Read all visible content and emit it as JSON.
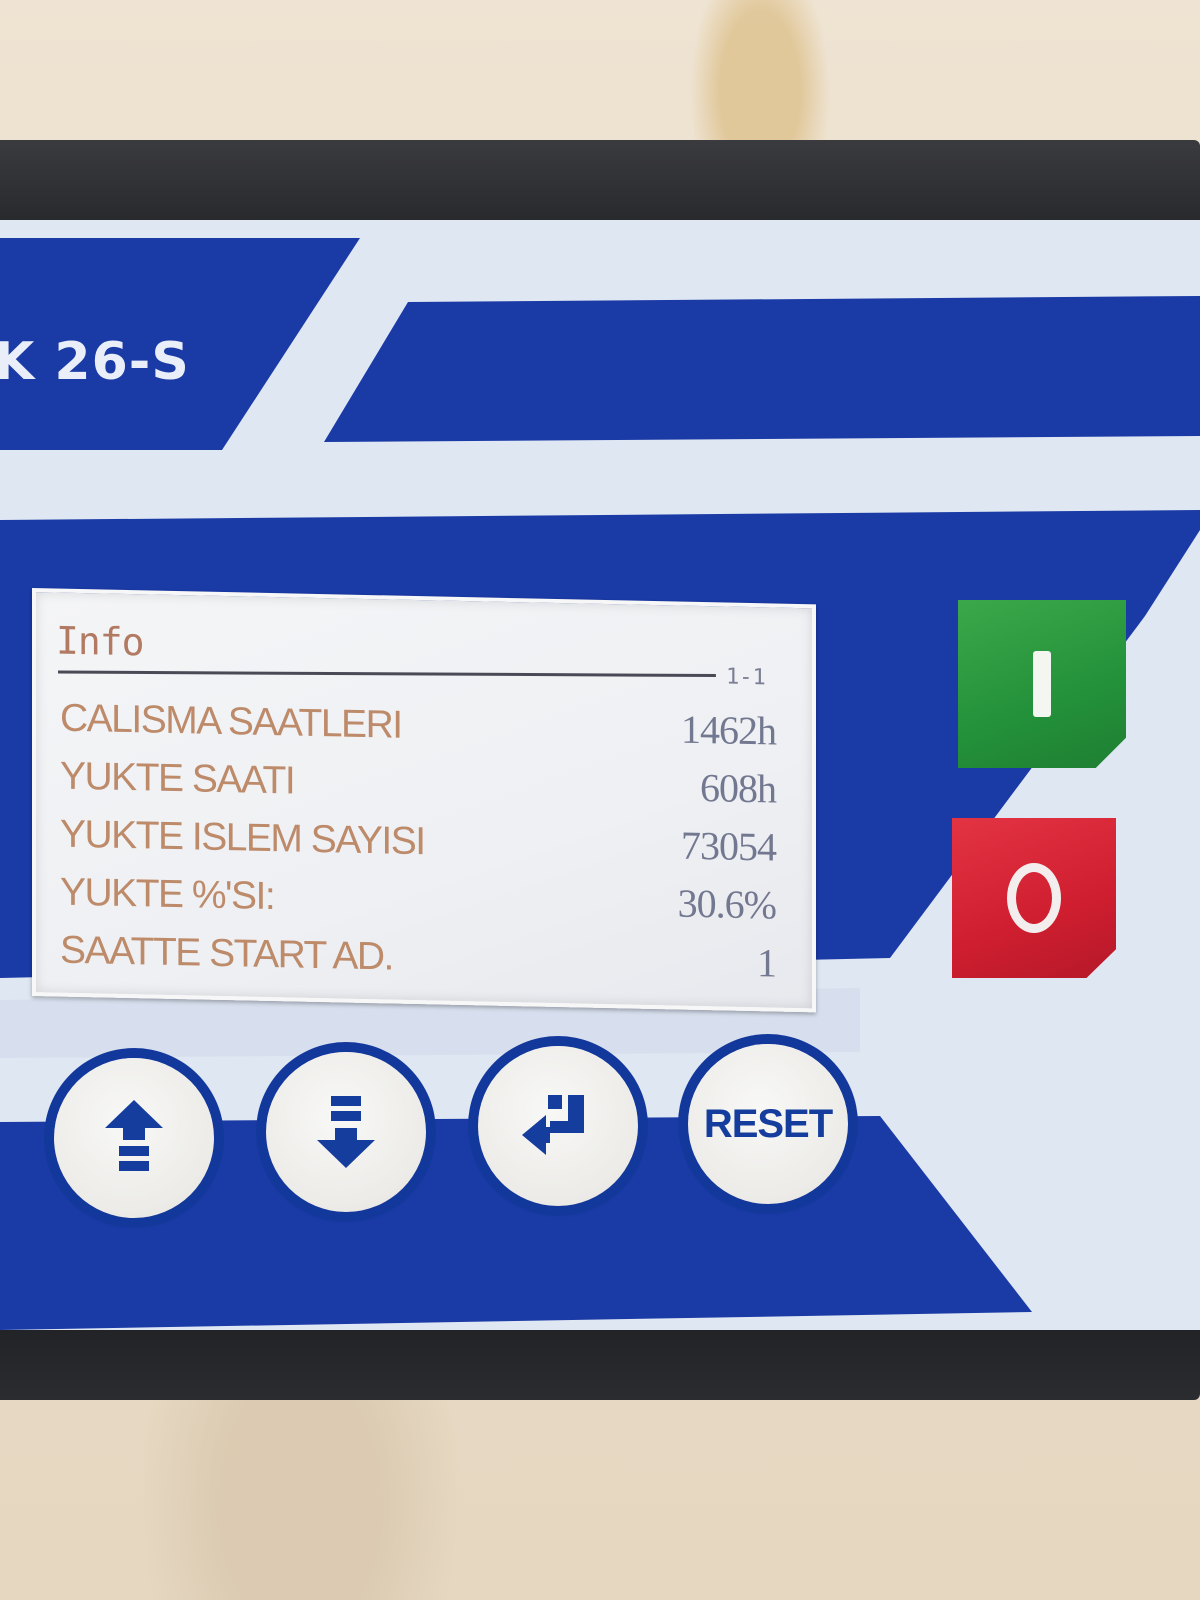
{
  "device": {
    "model_label": "K 26-S",
    "colors": {
      "panel_blue": "#1a3aa6",
      "panel_light": "#dfe7f3",
      "start_green": "#23913a",
      "stop_red": "#cf1e2f"
    }
  },
  "screen": {
    "title": "Info",
    "page_indicator": "1-1",
    "rows": [
      {
        "label": "CALISMA SAATLERI",
        "value": "1462h"
      },
      {
        "label": "YUKTE SAATI",
        "value": "608h"
      },
      {
        "label": "YUKTE ISLEM SAYISI",
        "value": "73054"
      },
      {
        "label": "YUKTE %'SI:",
        "value": "30.6%"
      },
      {
        "label": "SAATTE START AD.",
        "value": "1"
      }
    ]
  },
  "keys": {
    "start_label": "I",
    "stop_label": "O",
    "up_icon": "arrow-up-icon",
    "down_icon": "arrow-down-icon",
    "enter_icon": "enter-return-icon",
    "reset_label": "RESET"
  }
}
